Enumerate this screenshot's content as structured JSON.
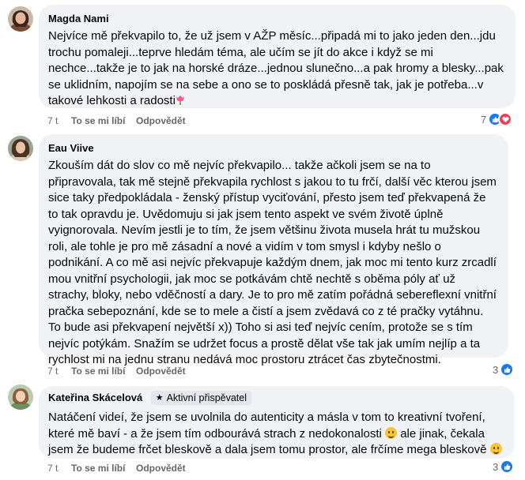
{
  "comments": [
    {
      "author": "Magda Nami",
      "text": "Nejvíce mě překvapilo to, že už jsem v AŽP měsíc...připadá mi to jako jeden den...jdu trochu pomaleji...teprve hledám téma, ale učím se jít do akce i když se mi nechce...takže je to jak na horské dráze...jednou slunečno...a pak hromy a blesky...pak se uklidním, napojím se na sebe a ono se to poskládá přesně tak, jak je potřeba...v takové lehkosti a radosti",
      "trailing_emoji": "tulip-emoji",
      "time": "7 t",
      "like_label": "To se mi líbí",
      "reply_label": "Odpovědět",
      "reaction_count": "7",
      "reactions": [
        "like-icon",
        "love-icon"
      ]
    },
    {
      "author": "Eau Viive",
      "text": "Zkouším dát do slov co mě nejvíc překvapilo... takže ačkoli jsem se na to připravovala, tak mě stejně překvapila rychlost s jakou to tu frčí, další věc kterou jsem sice taky předpokládala - ženský přístup vyciťování, přesto jsem teď překvapená že to tak opravdu je. Uvědomuju si jak jsem tento aspekt ve svém životě úplně vyignorovala. Nevím jestli je to tím, že jsem většinu života musela hrát tu mužskou roli, ale tohle je pro mě zásadní a nové a vidím v tom smysl i kdyby nešlo o podnikání. A co mě asi nejvíc překvapuje každým dnem, jak moc mi tento kurz zrcadlí mou vnitřní psychologii, jak moc se potkávám chtě nechtě s oběma póly ať už strachy, bloky, nebo vděčností a dary. Je to pro mě zatím pořádná sebereflexní vnitřní pračka sebepoznání, kde se to mele a čistí a jsem zvědavá co z té pračky vytáhnu. To bude asi překvapení největší x)) Toho si asi teď nejvíc cením, protože se s tím nejvíc potýkám. Snažím se udržet focus a prostě dělat vše tak jak umím nejlíp a ta rychlost mi na jednu stranu nedává moc prostoru ztrácet čas zbytečnostmi.",
      "time": "7 t",
      "like_label": "To se mi líbí",
      "reply_label": "Odpovědět",
      "reaction_count": "3",
      "reactions": [
        "like-icon"
      ]
    },
    {
      "author": "Kateřina Skácelová",
      "badge": "Aktivní přispěvatel",
      "text_part1": "Natáčení videí, že jsem se uvolnila do autenticity a másla v tom to kreativní tvoření, které mě baví - a že jsem tím odbourává strach z nedokonalosti",
      "text_part2": "ale jinak, čekala jsem že budeme frčet bleskově a dala jsem tomu prostor, ale frčíme mega bleskově",
      "time": "7 t",
      "like_label": "To se mi líbí",
      "reply_label": "Odpovědět",
      "reaction_count": "3",
      "reactions": [
        "like-icon"
      ]
    }
  ],
  "colors": {
    "bubble": "#f0f2f5",
    "meta": "#65676b",
    "like": "#1877f2",
    "love": "#f33e58"
  }
}
